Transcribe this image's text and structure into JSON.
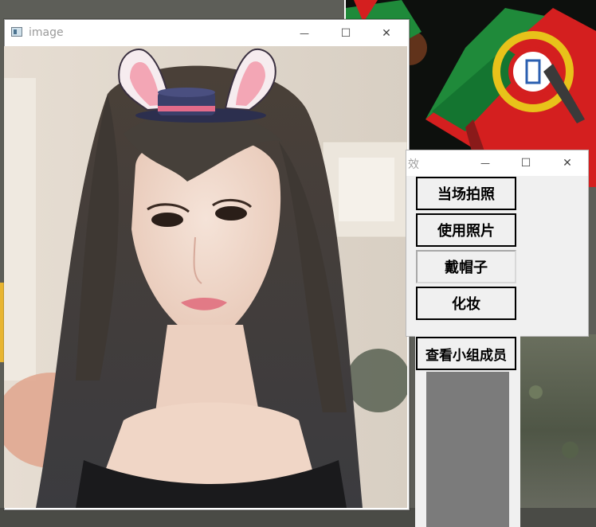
{
  "image_window": {
    "title": "image",
    "minimize_icon": "minimize-icon",
    "maximize_icon": "maximize-icon",
    "close_icon": "close-icon"
  },
  "control_window": {
    "title": "效",
    "buttons": [
      {
        "label": "当场拍照"
      },
      {
        "label": "使用照片"
      },
      {
        "label": "戴帽子"
      },
      {
        "label": "化妆"
      },
      {
        "label": "查看小组成员"
      }
    ]
  },
  "glyphs": {
    "minimize": "—",
    "maximize": "☐",
    "close": "✕"
  },
  "colors": {
    "flag_green": "#1f8a3a",
    "flag_red": "#d41f1f",
    "flag_gold": "#e8c21a",
    "hat_band": "#e36b8a",
    "hat_crown": "#3a3f6a"
  }
}
